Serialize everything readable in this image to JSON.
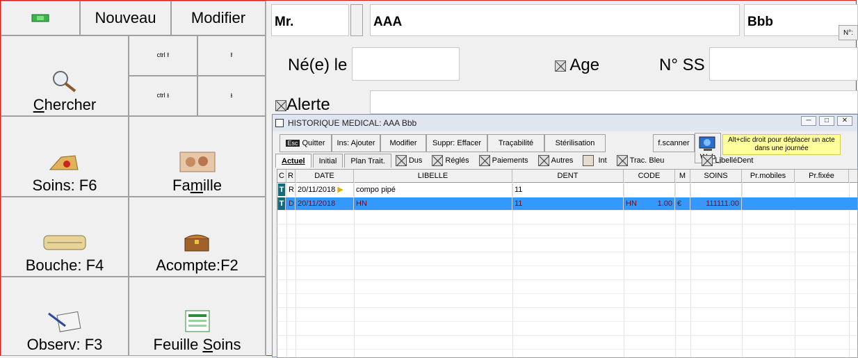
{
  "left_panel": {
    "new_label": "Nouveau",
    "edit_label": "Modifier",
    "search_label_pre": "",
    "search_label_u": "C",
    "search_label_post": "hercher",
    "ctrl_up": "ctrl",
    "ctrl_down": "ctrl",
    "soins_label": "Soins: F6",
    "famille_pre": "Fa",
    "famille_u": "m",
    "famille_post": "ille",
    "bouche_label": "Bouche: F4",
    "acompte_label": "Acompte:F2",
    "observ_label": "Observ: F3",
    "feuille_pre": "Feuille ",
    "feuille_u": "S",
    "feuille_post": "oins"
  },
  "patient": {
    "title": "Mr.",
    "last_name": "AAA",
    "first_name": "Bbb",
    "no_label": "N°:",
    "born_label": "Né(e) le",
    "born_value": "",
    "age_label": "Age",
    "ss_label": "N° SS",
    "alert_label": "Alerte"
  },
  "window": {
    "title": "HISTORIQUE MEDICAL: AAA Bbb",
    "toolbar": {
      "esc": "Esc",
      "quit": "Quitter",
      "insert": "Ins: Ajouter",
      "modify": "Modifier",
      "delete": "Suppr: Effacer",
      "traceability": "Traçabilité",
      "sterilisation": "Stérilisation",
      "scanner": "f.scanner",
      "web": "Web",
      "hint": "Alt+clic droit pour déplacer un acte dans une journée"
    },
    "tabs": [
      "Actuel",
      "Initial",
      "Plan Trait."
    ],
    "checks": [
      "Dus",
      "Réglés",
      "Paiements",
      "Autres",
      "Int",
      "Trac. Bleu",
      "LibelléDent"
    ],
    "columns": [
      "C",
      "R",
      "DATE",
      "LIBELLE",
      "DENT",
      "CODE",
      "M",
      "SOINS",
      "Pr.mobiles",
      "Pr.fixée"
    ],
    "rows": [
      {
        "c": "T",
        "r": "R",
        "date": "20/11/2018",
        "libelle": "compo pipé",
        "dent": "11",
        "code": "",
        "qty": "",
        "m": "",
        "soins": "",
        "flag": true
      },
      {
        "c": "T",
        "r": "D",
        "date": "20/11/2018",
        "libelle": "HN",
        "dent": "11",
        "code": "HN",
        "qty": "1.00",
        "m": "€",
        "soins": "111111.00",
        "flag": false
      }
    ]
  }
}
